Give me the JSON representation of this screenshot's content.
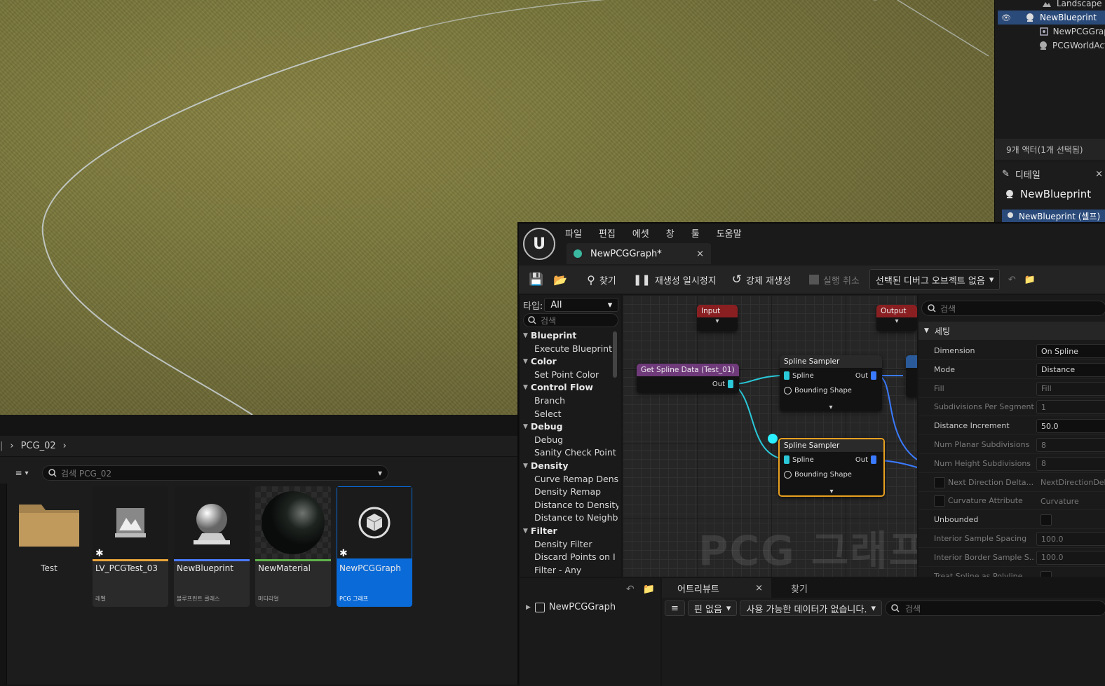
{
  "outliner": {
    "items": [
      {
        "name": "Landscape",
        "icon": "landscape-icon",
        "selected": false
      },
      {
        "name": "NewBlueprint",
        "icon": "actor-icon",
        "selected": true
      },
      {
        "name": "NewPCGGraph",
        "icon": "pcg-icon",
        "selected": false
      },
      {
        "name": "PCGWorldActor",
        "icon": "actor-icon",
        "selected": false
      }
    ],
    "count_text": "9개 액터(1개 선택됨)"
  },
  "details_panel": {
    "tab_label": "디테일",
    "title": "NewBlueprint",
    "selected_component": "NewBlueprint (셀프)"
  },
  "content_browser": {
    "breadcrumb": "PCG_02",
    "search_placeholder": "검색 PCG_02",
    "assets": [
      {
        "name": "Test",
        "type": "",
        "kind": "folder",
        "bar_color": "",
        "modified": false
      },
      {
        "name": "LV_PCGTest_03",
        "type": "레벨",
        "kind": "level",
        "bar_color": "#e8a33a",
        "modified": true
      },
      {
        "name": "NewBlueprint",
        "type": "블루프린트 클래스",
        "kind": "blueprint",
        "bar_color": "#4a7bff",
        "modified": false
      },
      {
        "name": "NewMaterial",
        "type": "머티리얼",
        "kind": "material",
        "bar_color": "#5fb24a",
        "modified": false
      },
      {
        "name": "NewPCGGraph",
        "type": "PCG 그래프",
        "kind": "pcg",
        "bar_color": "#0a6ad8",
        "modified": true
      }
    ]
  },
  "pcg_editor": {
    "menus": [
      "파일",
      "편집",
      "에셋",
      "창",
      "툴",
      "도움말"
    ],
    "tab_title": "NewPCGGraph*",
    "toolbar": {
      "find": "찾기",
      "pause": "재생성 일시정지",
      "force": "강제 재생성",
      "cancel": "실행 취소",
      "debug_object": "선택된 디버그 오브젝트 없음"
    },
    "palette": {
      "type_label": "타입:",
      "type_value": "All",
      "search_placeholder": "검색",
      "items": [
        {
          "label": "Blueprint",
          "cat": true
        },
        {
          "label": "Execute Blueprint",
          "cat": false
        },
        {
          "label": "Color",
          "cat": true
        },
        {
          "label": "Set Point Color",
          "cat": false
        },
        {
          "label": "Control Flow",
          "cat": true
        },
        {
          "label": "Branch",
          "cat": false
        },
        {
          "label": "Select",
          "cat": false
        },
        {
          "label": "Debug",
          "cat": true
        },
        {
          "label": "Debug",
          "cat": false
        },
        {
          "label": "Sanity Check Point",
          "cat": false
        },
        {
          "label": "Density",
          "cat": true
        },
        {
          "label": "Curve Remap Dens",
          "cat": false
        },
        {
          "label": "Density Remap",
          "cat": false
        },
        {
          "label": "Distance to Density",
          "cat": false
        },
        {
          "label": "Distance to Neighb",
          "cat": false
        },
        {
          "label": "Filter",
          "cat": true
        },
        {
          "label": "Density Filter",
          "cat": false
        },
        {
          "label": "Discard Points on I",
          "cat": false
        },
        {
          "label": "Filter - Any",
          "cat": false
        }
      ]
    },
    "graph": {
      "watermark": "PCG 그래프",
      "input_node": "Input",
      "output_node": "Output",
      "get_spline_node": "Get Spline Data (Test_01)",
      "out_label": "Out",
      "sampler_title": "Spline Sampler",
      "spline_pin": "Spline",
      "bounding_pin": "Bounding Shape"
    },
    "details": {
      "search_placeholder": "검색",
      "category": "세팅",
      "props": [
        {
          "label": "Dimension",
          "value": "On Spline",
          "dim": false,
          "kind": "value"
        },
        {
          "label": "Mode",
          "value": "Distance",
          "dim": false,
          "kind": "value"
        },
        {
          "label": "Fill",
          "value": "Fill",
          "dim": true,
          "kind": "value"
        },
        {
          "label": "Subdivisions Per Segment",
          "value": "1",
          "dim": true,
          "kind": "value"
        },
        {
          "label": "Distance Increment",
          "value": "50.0",
          "dim": false,
          "kind": "value"
        },
        {
          "label": "Num Planar Subdivisions",
          "value": "8",
          "dim": true,
          "kind": "value"
        },
        {
          "label": "Num Height Subdivisions",
          "value": "8",
          "dim": true,
          "kind": "value"
        },
        {
          "label": "Next Direction Delta...",
          "value": "NextDirectionDelta",
          "dim": true,
          "kind": "checklabel"
        },
        {
          "label": "Curvature Attribute",
          "value": "Curvature",
          "dim": true,
          "kind": "checklabel"
        },
        {
          "label": "Unbounded",
          "value": "",
          "dim": false,
          "kind": "check"
        },
        {
          "label": "Interior Sample Spacing",
          "value": "100.0",
          "dim": true,
          "kind": "value"
        },
        {
          "label": "Interior Border Sample S...",
          "value": "100.0",
          "dim": true,
          "kind": "value"
        },
        {
          "label": "Treat Spline as Polyline",
          "value": "",
          "dim": true,
          "kind": "check"
        }
      ]
    },
    "bottom": {
      "tree_item": "NewPCGGraph",
      "tab_attribute": "어트리뷰트",
      "tab_find": "찾기",
      "pin_btn": "핀 없음",
      "data_btn": "사용 가능한 데이터가 없습니다.",
      "search_placeholder": "검색"
    }
  }
}
